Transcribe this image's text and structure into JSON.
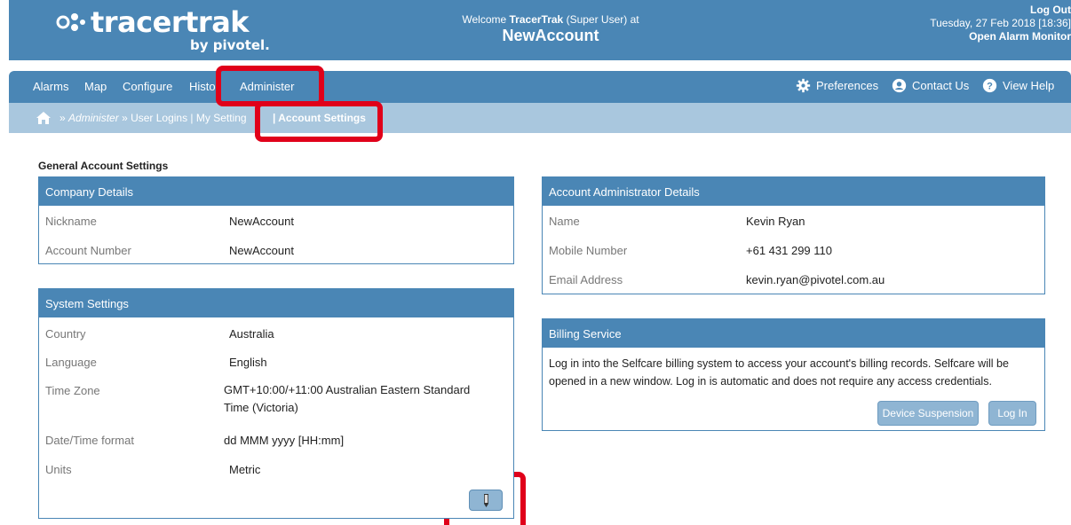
{
  "header": {
    "logo_text": "tracertrak",
    "logo_sub": "by pivotel.",
    "welcome_prefix": "Welcome",
    "welcome_user": "TracerTrak",
    "welcome_suffix": "(Super User) at",
    "account_name": "NewAccount",
    "logout": "Log Out",
    "datetime": "Tuesday, 27 Feb 2018 [18:36]",
    "alarm_monitor": "Open Alarm Monitor"
  },
  "nav": {
    "items": [
      "Alarms",
      "Map",
      "Configure",
      "Histo",
      "Administer"
    ],
    "preferences": "Preferences",
    "contact": "Contact Us",
    "help": "View Help"
  },
  "breadcrumb": {
    "path": "» Administer » User Logins | My Setting",
    "path_prefix": "»",
    "path_admin": "Administer",
    "path_rest": "» User Logins | My Setting",
    "current": "| Account Settings"
  },
  "general": {
    "title": "General Account Settings",
    "company": {
      "header": "Company Details",
      "rows": [
        {
          "label": "Nickname",
          "value": "NewAccount"
        },
        {
          "label": "Account Number",
          "value": "NewAccount"
        }
      ]
    },
    "system": {
      "header": "System Settings",
      "rows": [
        {
          "label": "Country",
          "value": "Australia"
        },
        {
          "label": "Language",
          "value": "English"
        },
        {
          "label": "Time Zone",
          "value": "GMT+10:00/+11:00 Australian Eastern Standard Time (Victoria)"
        },
        {
          "label": "Date/Time format",
          "value": "dd MMM yyyy [HH:mm]"
        },
        {
          "label": "Units",
          "value": "Metric"
        }
      ]
    },
    "admin": {
      "header": "Account Administrator Details",
      "rows": [
        {
          "label": "Name",
          "value": "Kevin Ryan"
        },
        {
          "label": "Mobile Number",
          "value": "+61 431 299 110"
        },
        {
          "label": "Email Address",
          "value": "kevin.ryan@pivotel.com.au"
        }
      ]
    },
    "billing": {
      "header": "Billing Service",
      "text": "Log in into the Selfcare billing system to access your account's billing records. Selfcare will be opened in a new window. Log in is automatic and does not require any access credentials.",
      "suspension_button": "Device Suspension",
      "login_button": "Log In"
    }
  },
  "colors": {
    "primary": "#4a86b5",
    "breadcrumb": "#a9c7de",
    "highlight": "#e0001a"
  }
}
